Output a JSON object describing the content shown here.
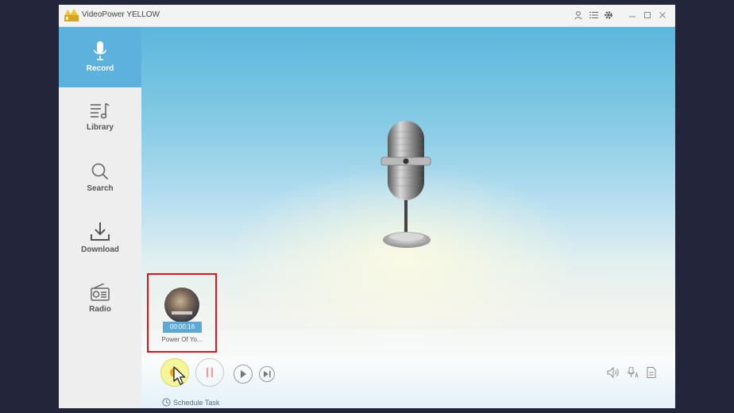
{
  "app": {
    "title": "VideoPower YELLOW",
    "logo_icon": "crown-logo-icon"
  },
  "titlebar": {
    "icons": [
      "user-icon",
      "list-icon",
      "gear-icon",
      "minimize-icon",
      "maximize-icon",
      "close-icon"
    ]
  },
  "sidebar": {
    "items": [
      {
        "label": "Record",
        "icon": "microphone-icon",
        "active": true
      },
      {
        "label": "Library",
        "icon": "music-list-icon",
        "active": false
      },
      {
        "label": "Search",
        "icon": "search-icon",
        "active": false
      },
      {
        "label": "Download",
        "icon": "download-icon",
        "active": false
      },
      {
        "label": "Radio",
        "icon": "radio-icon",
        "active": false
      }
    ]
  },
  "colors": {
    "accent": "#5cb2dd",
    "highlight": "#e1141c",
    "record": "#f0a21c"
  },
  "track": {
    "duration": "00:00:16",
    "title": "Power Of Yo..."
  },
  "controls": {
    "left": [
      "record-icon",
      "pause-icon",
      "play-icon",
      "next-icon"
    ],
    "right": [
      "volume-icon",
      "microphone-settings-icon",
      "file-icon"
    ]
  },
  "schedule": {
    "label": "Schedule Task",
    "icon": "clock-icon"
  }
}
